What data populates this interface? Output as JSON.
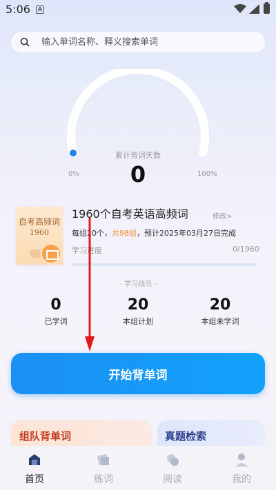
{
  "status_bar": {
    "time": "5:06",
    "notification_glyph": "A"
  },
  "search": {
    "placeholder": "输入单词名称、释义搜索单词"
  },
  "gauge": {
    "label": "累计背词天数",
    "value": "0",
    "min_label": "0%",
    "max_label": "100%",
    "progress_fraction": 0
  },
  "wordbook": {
    "cover_title": "自考高频词",
    "cover_year": "1960",
    "title": "1960个自考英语高频词",
    "edit_label": "修改>",
    "info_prefix": "每组20个，",
    "info_groups": "共98组",
    "info_suffix": "，预计2025年03月27日完成",
    "progress_label": "学习进度",
    "progress_count": "0/1960",
    "progress_fraction": 0
  },
  "stats": {
    "title": "- 学习战况 -",
    "items": [
      {
        "value": "0",
        "label": "已学词"
      },
      {
        "value": "20",
        "label": "本组计划"
      },
      {
        "value": "20",
        "label": "本组未学词"
      }
    ]
  },
  "start_button": {
    "label": "开始背单词"
  },
  "feature_cards": {
    "team": "组队背单词",
    "exam": "真题检索"
  },
  "tabs": [
    {
      "label": "首页",
      "icon": "home-icon",
      "active": true
    },
    {
      "label": "练词",
      "icon": "practice-icon",
      "active": false
    },
    {
      "label": "阅读",
      "icon": "reading-icon",
      "active": false
    },
    {
      "label": "我的",
      "icon": "profile-icon",
      "active": false
    }
  ],
  "colors": {
    "accent": "#1c8ff3",
    "highlight": "#f28a1e",
    "annotation_arrow": "#e01b1b"
  }
}
